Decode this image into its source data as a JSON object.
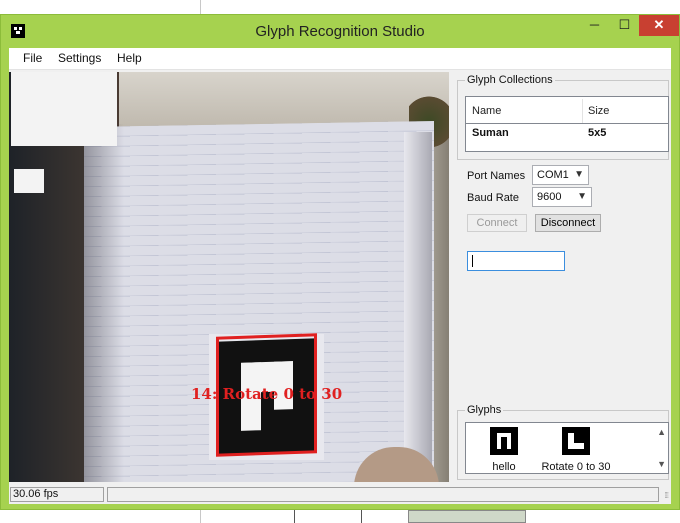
{
  "window": {
    "title": "Glyph Recognition Studio",
    "controls": {
      "minimize": "─",
      "maximize": "☐",
      "close": "✕"
    }
  },
  "menu": [
    "File",
    "Settings",
    "Help"
  ],
  "video": {
    "overlay_label": "14: Rotate 0 to 30",
    "highlight_color": "#e02020"
  },
  "glyph_collections": {
    "title": "Glyph Collections",
    "columns": [
      "Name",
      "Size"
    ],
    "rows": [
      {
        "name": "Suman",
        "size": "5x5"
      }
    ]
  },
  "serial": {
    "port_label": "Port Names",
    "port_value": "COM1",
    "baud_label": "Baud Rate",
    "baud_value": "9600",
    "connect_label": "Connect",
    "disconnect_label": "Disconnect",
    "input_value": ""
  },
  "glyphs": {
    "title": "Glyphs",
    "items": [
      {
        "name": "hello",
        "icon": "glyph-hello-icon"
      },
      {
        "name": "Rotate 0 to 30",
        "icon": "glyph-rotate-icon"
      }
    ]
  },
  "status": {
    "fps": "30.06 fps"
  },
  "colors": {
    "title_bar": "#a6d24f",
    "close_button": "#c84031"
  }
}
